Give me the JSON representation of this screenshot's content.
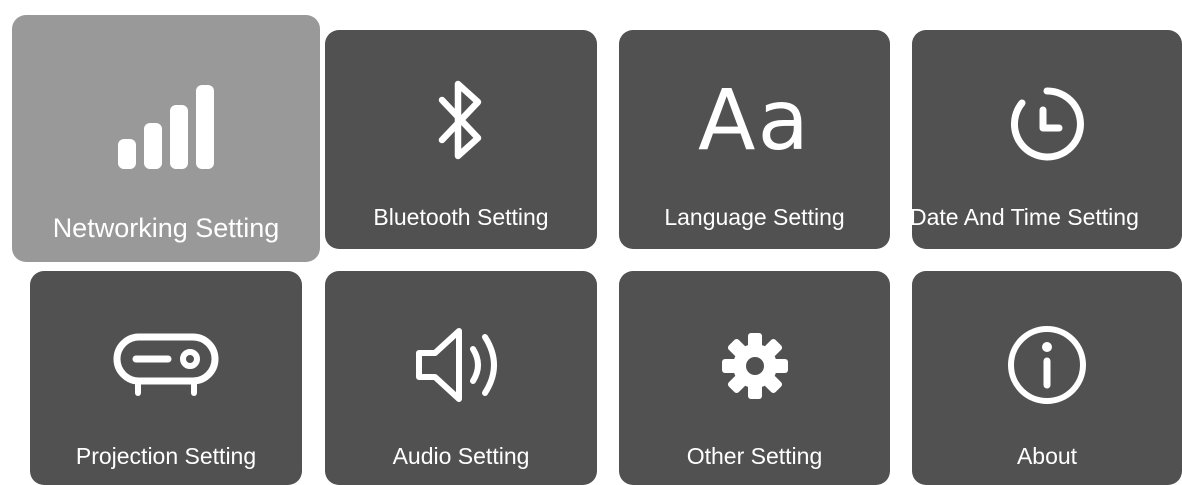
{
  "tiles": [
    {
      "id": "networking",
      "label": "Networking Setting",
      "icon": "signal-bars-icon",
      "selected": true
    },
    {
      "id": "bluetooth",
      "label": "Bluetooth Setting",
      "icon": "bluetooth-icon",
      "selected": false
    },
    {
      "id": "language",
      "label": "Language Setting",
      "icon": "language-aa-icon",
      "selected": false
    },
    {
      "id": "datetime",
      "label": "Date And Time Setting",
      "icon": "clock-icon",
      "selected": false
    },
    {
      "id": "projection",
      "label": "Projection Setting",
      "icon": "projector-icon",
      "selected": false
    },
    {
      "id": "audio",
      "label": "Audio Setting",
      "icon": "speaker-icon",
      "selected": false
    },
    {
      "id": "other",
      "label": "Other Setting",
      "icon": "gear-icon",
      "selected": false
    },
    {
      "id": "about",
      "label": "About",
      "icon": "info-icon",
      "selected": false
    }
  ],
  "language_icon_text": "Aa",
  "colors": {
    "tile": "#515151",
    "tile_selected": "#999999",
    "icon": "#ffffff"
  }
}
